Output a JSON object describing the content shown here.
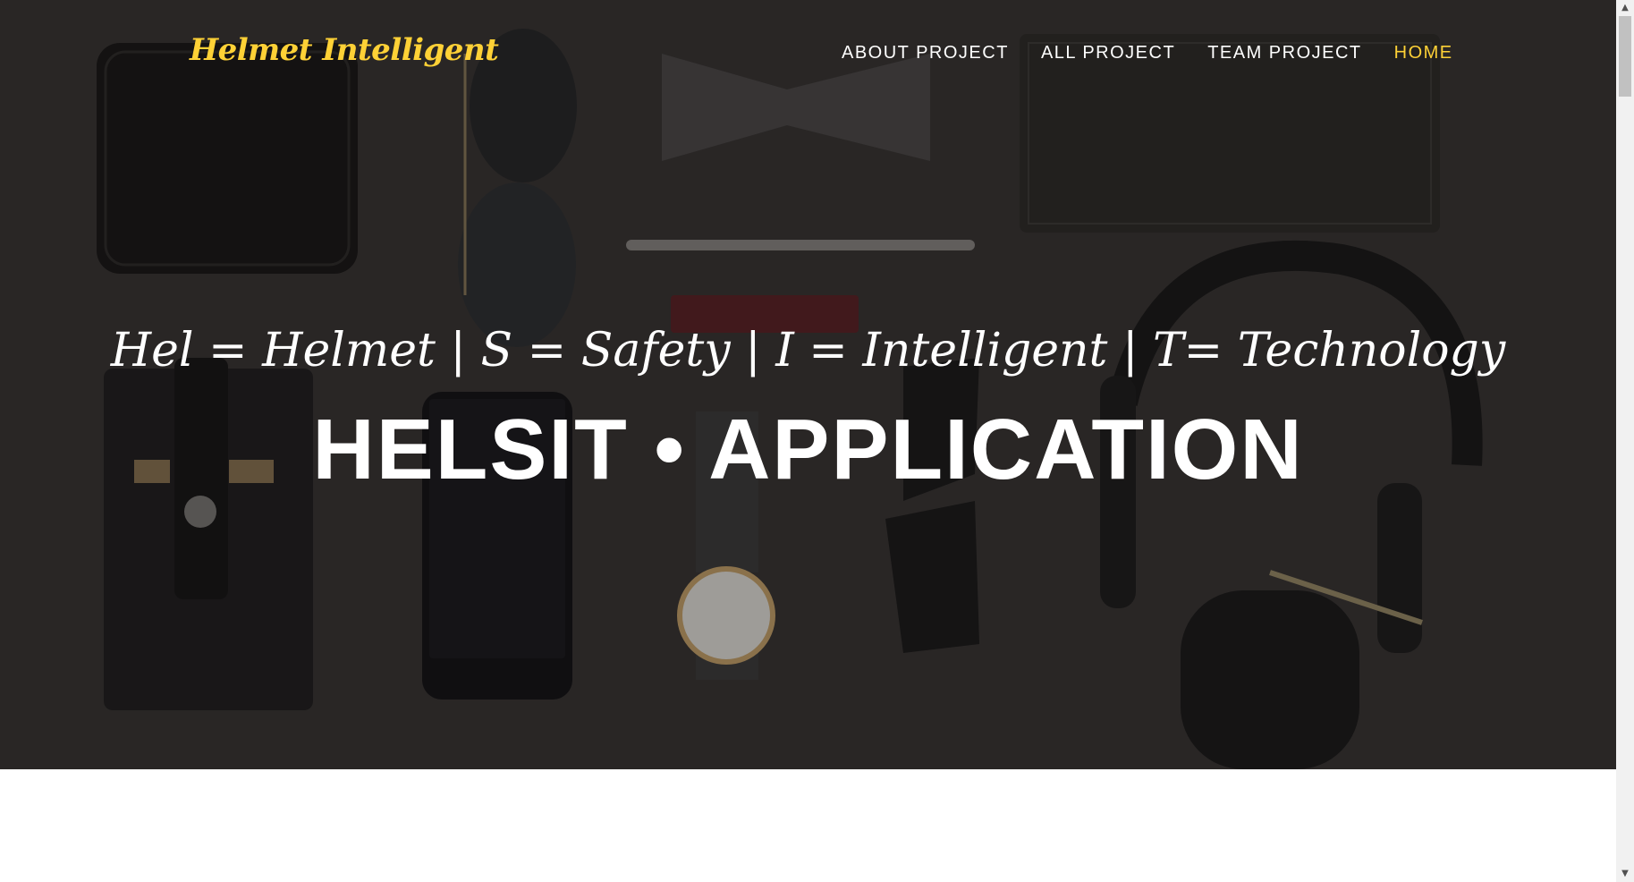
{
  "navbar": {
    "brand": "Helmet Intelligent",
    "links": [
      {
        "label": "ABOUT PROJECT"
      },
      {
        "label": "ALL PROJECT"
      },
      {
        "label": "TEAM PROJECT"
      },
      {
        "label": "HOME"
      }
    ],
    "active_link": "HOME"
  },
  "hero": {
    "subheading": "Hel = Helmet | S = Safety | I = Intelligent | T= Technology",
    "heading": "HELSIT • APPLICATION"
  },
  "colors": {
    "accent": "#fed136",
    "hero_text": "#ffffff",
    "hero_bg": "#2f2d2c"
  },
  "scrollbar": {
    "up_icon": "chevron-up-icon",
    "down_icon": "chevron-down-icon"
  }
}
